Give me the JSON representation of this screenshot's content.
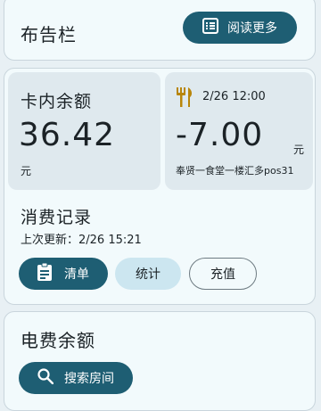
{
  "notice": {
    "title": "布告栏",
    "read_more": "阅读更多"
  },
  "campus": {
    "balance_label": "卡内余额",
    "balance_value": "36.42",
    "balance_unit": "元",
    "last_txn_time": "2/26 12:00",
    "last_txn_amount": "-7.00",
    "last_txn_unit": "元",
    "last_txn_place": "奉贤一食堂一楼汇多pos31",
    "records_title": "消费记录",
    "last_update": "上次更新：2/26 15:21",
    "buttons": {
      "list": "清单",
      "stats": "统计",
      "recharge": "充值"
    }
  },
  "electric": {
    "title": "电费余额",
    "search_room": "搜索房间"
  },
  "colors": {
    "accent": "#1e5e73",
    "fork_icon": "#b8860b"
  }
}
